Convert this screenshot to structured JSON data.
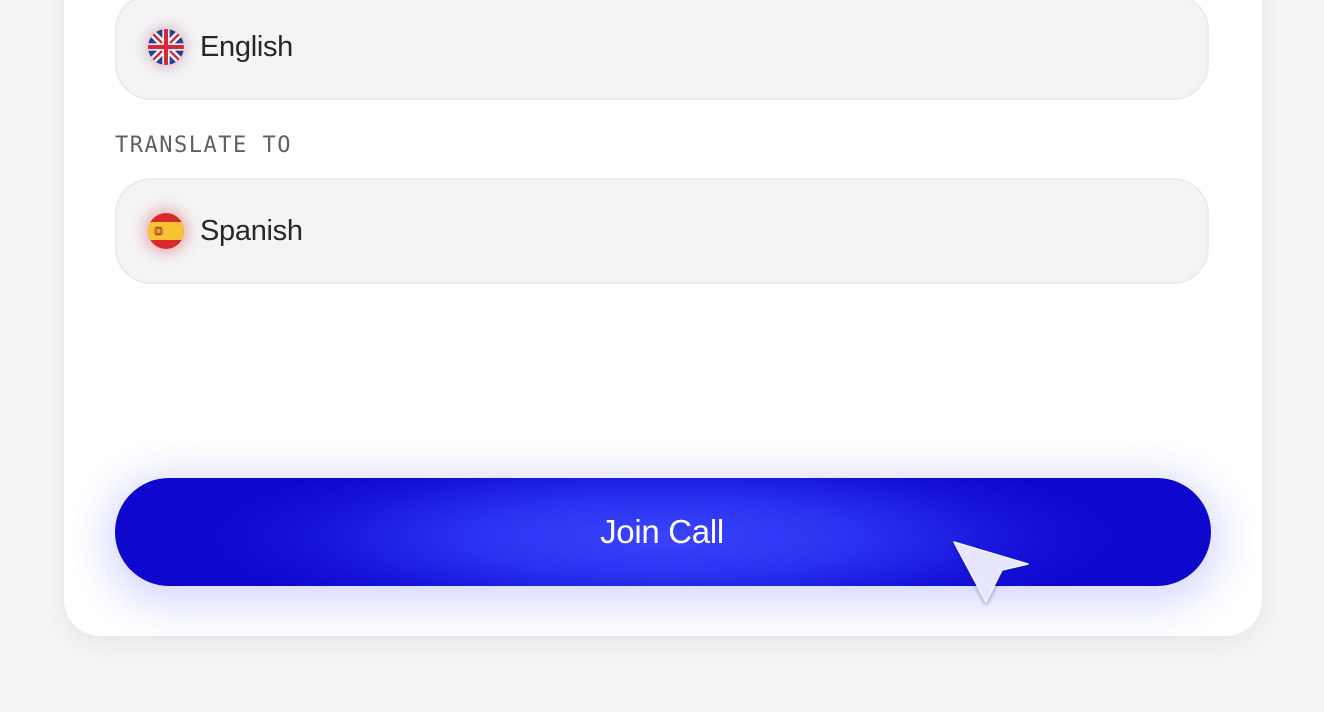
{
  "source_language": {
    "label": "English",
    "flag_icon": "uk-flag-icon"
  },
  "target_section": {
    "label": "TRANSLATE TO"
  },
  "target_language": {
    "label": "Spanish",
    "flag_icon": "spain-flag-icon"
  },
  "join_button": {
    "label": "Join Call",
    "color": "#1a1ae6"
  },
  "pointer": {
    "icon": "cursor-arrow-icon"
  }
}
